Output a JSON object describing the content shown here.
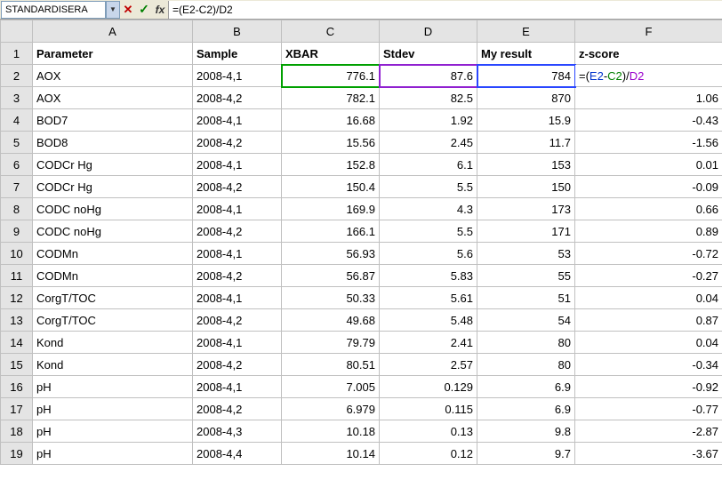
{
  "formula_bar": {
    "name_box": "STANDARDISERA",
    "formula_text": "=(E2-C2)/D2"
  },
  "columns": [
    "A",
    "B",
    "C",
    "D",
    "E",
    "F"
  ],
  "active": {
    "row": 2,
    "col": "F"
  },
  "headers": {
    "A": "Parameter",
    "B": "Sample",
    "C": "XBAR",
    "D": "Stdev",
    "E": "My result",
    "F": "z-score"
  },
  "editing_cell": {
    "prefix": "=(",
    "ref1": "E2",
    "mid1": "-",
    "ref2": "C2",
    "mid2": ")/",
    "ref3": "D2"
  },
  "rows": [
    {
      "n": 2,
      "A": "AOX",
      "B": "2008-4,1",
      "C": "776.1",
      "D": "87.6",
      "E": "784",
      "F": ""
    },
    {
      "n": 3,
      "A": "AOX",
      "B": "2008-4,2",
      "C": "782.1",
      "D": "82.5",
      "E": "870",
      "F": "1.06"
    },
    {
      "n": 4,
      "A": "BOD7",
      "B": "2008-4,1",
      "C": "16.68",
      "D": "1.92",
      "E": "15.9",
      "F": "-0.43"
    },
    {
      "n": 5,
      "A": "BOD8",
      "B": "2008-4,2",
      "C": "15.56",
      "D": "2.45",
      "E": "11.7",
      "F": "-1.56"
    },
    {
      "n": 6,
      "A": "CODCr Hg",
      "B": "2008-4,1",
      "C": "152.8",
      "D": "6.1",
      "E": "153",
      "F": "0.01"
    },
    {
      "n": 7,
      "A": "CODCr Hg",
      "B": "2008-4,2",
      "C": "150.4",
      "D": "5.5",
      "E": "150",
      "F": "-0.09"
    },
    {
      "n": 8,
      "A": "CODC noHg",
      "B": "2008-4,1",
      "C": "169.9",
      "D": "4.3",
      "E": "173",
      "F": "0.66"
    },
    {
      "n": 9,
      "A": "CODC noHg",
      "B": "2008-4,2",
      "C": "166.1",
      "D": "5.5",
      "E": "171",
      "F": "0.89"
    },
    {
      "n": 10,
      "A": "CODMn",
      "B": "2008-4,1",
      "C": "56.93",
      "D": "5.6",
      "E": "53",
      "F": "-0.72"
    },
    {
      "n": 11,
      "A": "CODMn",
      "B": "2008-4,2",
      "C": "56.87",
      "D": "5.83",
      "E": "55",
      "F": "-0.27"
    },
    {
      "n": 12,
      "A": "CorgT/TOC",
      "B": "2008-4,1",
      "C": "50.33",
      "D": "5.61",
      "E": "51",
      "F": "0.04"
    },
    {
      "n": 13,
      "A": "CorgT/TOC",
      "B": "2008-4,2",
      "C": "49.68",
      "D": "5.48",
      "E": "54",
      "F": "0.87"
    },
    {
      "n": 14,
      "A": "Kond",
      "B": "2008-4,1",
      "C": "79.79",
      "D": "2.41",
      "E": "80",
      "F": "0.04"
    },
    {
      "n": 15,
      "A": "Kond",
      "B": "2008-4,2",
      "C": "80.51",
      "D": "2.57",
      "E": "80",
      "F": "-0.34"
    },
    {
      "n": 16,
      "A": "pH",
      "B": "2008-4,1",
      "C": "7.005",
      "D": "0.129",
      "E": "6.9",
      "F": "-0.92"
    },
    {
      "n": 17,
      "A": "pH",
      "B": "2008-4,2",
      "C": "6.979",
      "D": "0.115",
      "E": "6.9",
      "F": "-0.77"
    },
    {
      "n": 18,
      "A": "pH",
      "B": "2008-4,3",
      "C": "10.18",
      "D": "0.13",
      "E": "9.8",
      "F": "-2.87"
    },
    {
      "n": 19,
      "A": "pH",
      "B": "2008-4,4",
      "C": "10.14",
      "D": "0.12",
      "E": "9.7",
      "F": "-3.67"
    }
  ]
}
